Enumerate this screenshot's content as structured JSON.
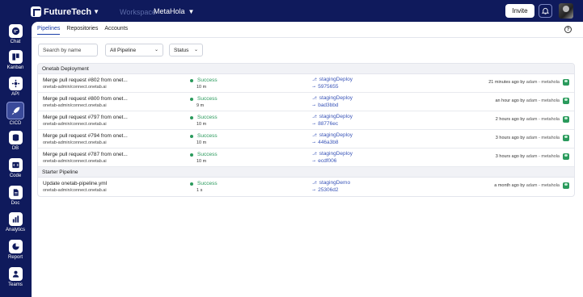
{
  "app": {
    "brand": "FutureTech",
    "workspace_label": "Workspace",
    "workspace_name": "MetaHola"
  },
  "topbar": {
    "invite_label": "Invite"
  },
  "sidebar": {
    "items": [
      {
        "label": "Chat",
        "icon": "chat-icon"
      },
      {
        "label": "Kanban",
        "icon": "kanban-icon"
      },
      {
        "label": "API",
        "icon": "api-icon"
      },
      {
        "label": "CICD",
        "icon": "rocket-icon",
        "active": true
      },
      {
        "label": "DB",
        "icon": "database-icon"
      },
      {
        "label": "Code",
        "icon": "code-icon"
      },
      {
        "label": "Doc",
        "icon": "document-icon"
      },
      {
        "label": "Analytics",
        "icon": "analytics-icon"
      },
      {
        "label": "Report",
        "icon": "report-icon"
      },
      {
        "label": "Teams",
        "icon": "teams-icon"
      }
    ]
  },
  "tabs": [
    {
      "label": "Pipelines",
      "active": true
    },
    {
      "label": "Repositories"
    },
    {
      "label": "Accounts"
    }
  ],
  "filters": {
    "search_placeholder": "Search by name",
    "pipeline_select": "All Pipeline",
    "status_select": "Status"
  },
  "groups": [
    {
      "name": "Onetab Deployment",
      "rows": [
        {
          "title": "Merge pull request #802 from onet...",
          "repo": "onetab-admin/connect.onetab.ai",
          "status": "Success",
          "duration": "10 m",
          "branch": "stagingDeploy",
          "commit": "5975655",
          "when": "21 minutes ago by",
          "who": "adam - metahola"
        },
        {
          "title": "Merge pull request #800 from onet...",
          "repo": "onetab-admin/connect.onetab.ai",
          "status": "Success",
          "duration": "9 m",
          "branch": "stagingDeploy",
          "commit": "bad3bbd",
          "when": "an hour ago by",
          "who": "adam - metahola"
        },
        {
          "title": "Merge pull request #797 from onet...",
          "repo": "onetab-admin/connect.onetab.ai",
          "status": "Success",
          "duration": "10 m",
          "branch": "stagingDeploy",
          "commit": "88776ec",
          "when": "2 hours ago by",
          "who": "adam - metahola"
        },
        {
          "title": "Merge pull request #794 from onet...",
          "repo": "onetab-admin/connect.onetab.ai",
          "status": "Success",
          "duration": "10 m",
          "branch": "stagingDeploy",
          "commit": "446a3b8",
          "when": "3 hours ago by",
          "who": "adam - metahola"
        },
        {
          "title": "Merge pull request #787 from onet...",
          "repo": "onetab-admin/connect.onetab.ai",
          "status": "Success",
          "duration": "10 m",
          "branch": "stagingDeploy",
          "commit": "ecdf006",
          "when": "3 hours ago by",
          "who": "adam - metahola"
        }
      ]
    },
    {
      "name": "Starter Pipeline",
      "rows": [
        {
          "title": "Update onetab-pipeline.yml",
          "repo": "onetab-admin/connect.onetab.ai",
          "status": "Success",
          "duration": "1 s",
          "branch": "stagingDemo",
          "commit": "25306d2",
          "when": "a month ago by",
          "who": "adam - metahola"
        }
      ]
    }
  ],
  "colors": {
    "nav_bg": "#0f1a5c",
    "success": "#2a9a5c",
    "link": "#3a55b8",
    "tab_active": "#1a3ea8"
  }
}
